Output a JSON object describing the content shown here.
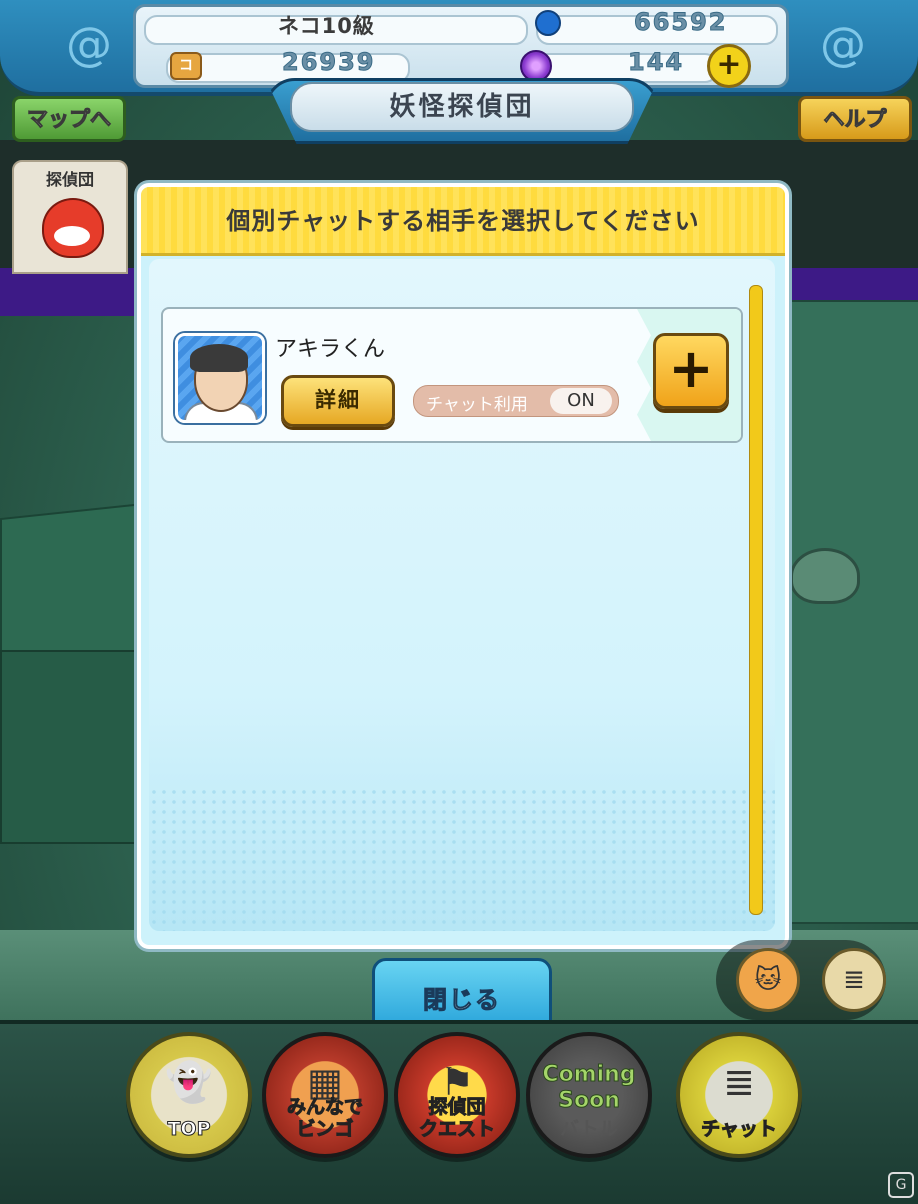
{
  "header": {
    "rank": "ネコ10級",
    "bombs": "66592",
    "money": "26939",
    "orbs": "144",
    "plus_symbol": "+",
    "coin_glyph": "コ",
    "title": "妖怪探偵団"
  },
  "nav_buttons": {
    "map": "マップへ",
    "help": "ヘルプ"
  },
  "left_tab": {
    "label": "探偵団"
  },
  "dialog": {
    "title": "個別チャットする相手を選択してください",
    "players": [
      {
        "name": "アキラくん",
        "detail_label": "詳細",
        "chat_label": "チャット利用",
        "chat_state": "ON",
        "add_symbol": "+"
      }
    ]
  },
  "close_button": "閉じる",
  "bottom_nav": [
    {
      "label": "TOP"
    },
    {
      "label": "みんなで\nビンゴ"
    },
    {
      "label": "探偵団\nクエスト"
    },
    {
      "label": "バトル",
      "badge": "Coming\nSoon"
    },
    {
      "label": "チャット"
    }
  ],
  "icons": {
    "swirl": "@",
    "chat_icon": "≣"
  },
  "watermark": "G"
}
